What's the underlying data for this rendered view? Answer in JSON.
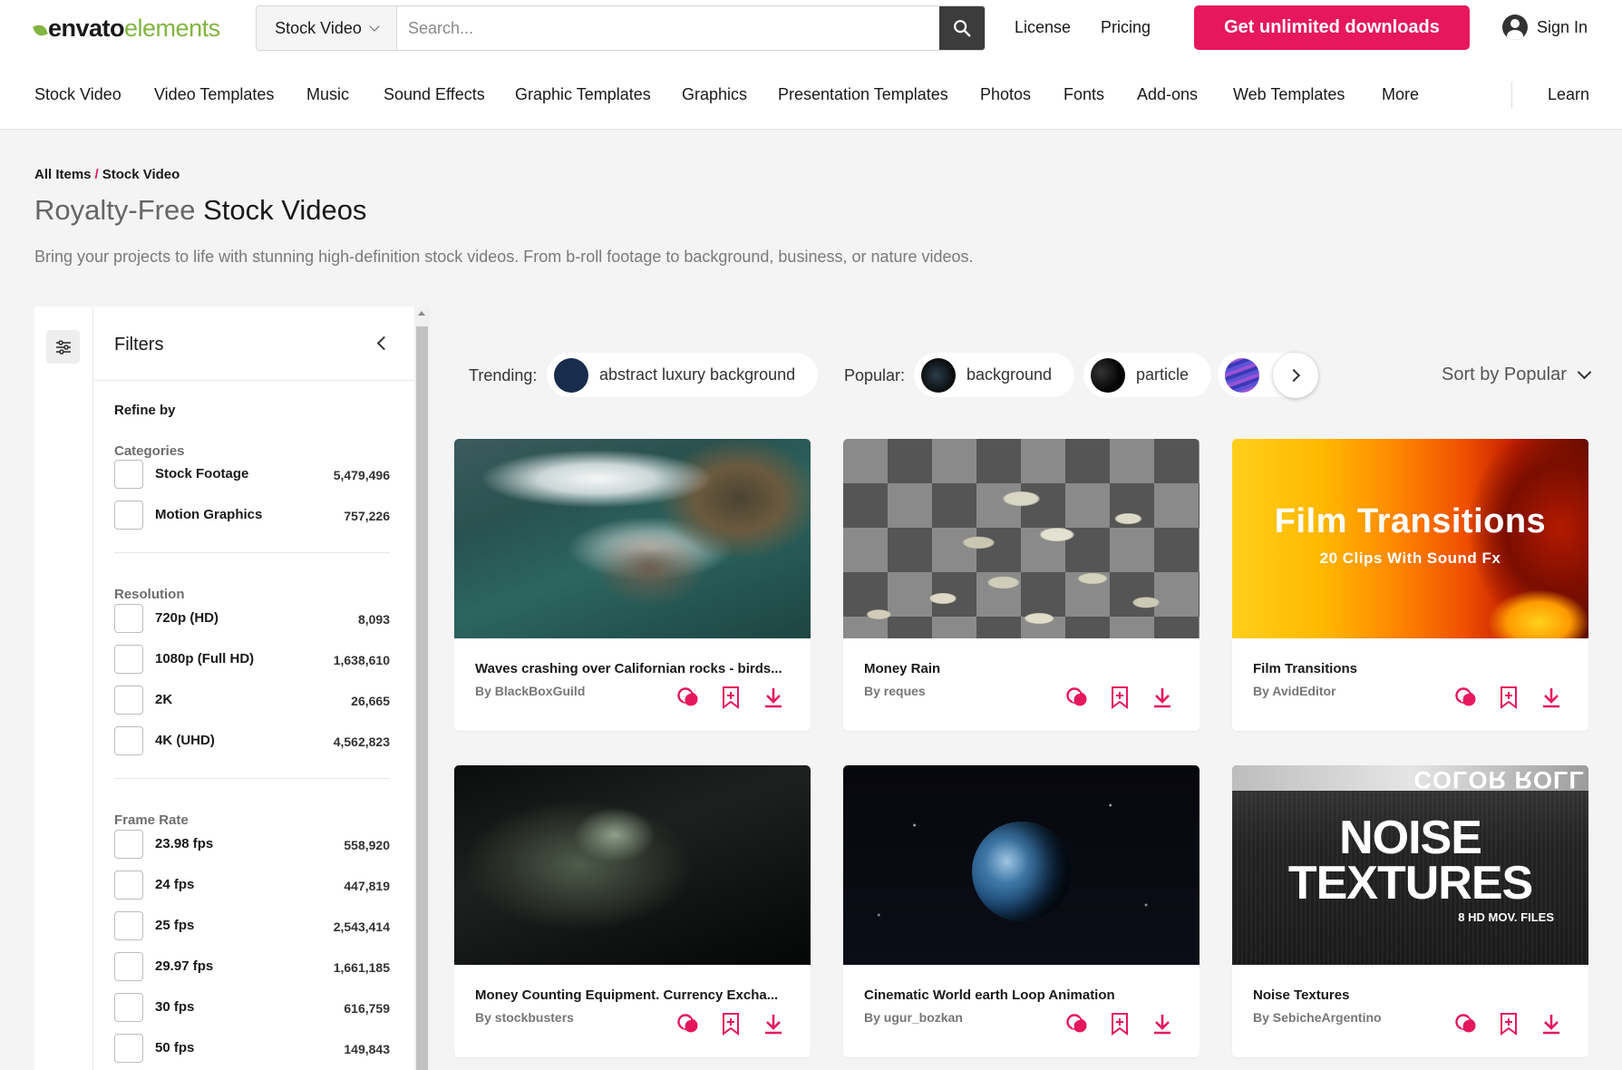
{
  "header": {
    "logo_part1": "envato",
    "logo_part2": "elements",
    "search_category": "Stock Video",
    "search_placeholder": "Search...",
    "license_link": "License",
    "pricing_link": "Pricing",
    "cta_button": "Get unlimited downloads",
    "sign_in": "Sign In"
  },
  "nav": {
    "items": [
      "Stock Video",
      "Video Templates",
      "Music",
      "Sound Effects",
      "Graphic Templates",
      "Graphics",
      "Presentation Templates",
      "Photos",
      "Fonts",
      "Add-ons",
      "Web Templates",
      "More"
    ],
    "learn": "Learn"
  },
  "hero": {
    "breadcrumb_root": "All Items",
    "breadcrumb_sep": "/",
    "breadcrumb_current": "Stock Video",
    "title_light": "Royalty-Free",
    "title_bold": "Stock Videos",
    "description": "Bring your projects to life with stunning high-definition stock videos. From b-roll footage to background, business, or nature videos."
  },
  "filters": {
    "title": "Filters",
    "refine_by": "Refine by",
    "groups": [
      {
        "name": "Categories",
        "options": [
          {
            "label": "Stock Footage",
            "count": "5,479,496"
          },
          {
            "label": "Motion Graphics",
            "count": "757,226"
          }
        ]
      },
      {
        "name": "Resolution",
        "options": [
          {
            "label": "720p (HD)",
            "count": "8,093"
          },
          {
            "label": "1080p (Full HD)",
            "count": "1,638,610"
          },
          {
            "label": "2K",
            "count": "26,665"
          },
          {
            "label": "4K (UHD)",
            "count": "4,562,823"
          }
        ]
      },
      {
        "name": "Frame Rate",
        "options": [
          {
            "label": "23.98 fps",
            "count": "558,920"
          },
          {
            "label": "24 fps",
            "count": "447,819"
          },
          {
            "label": "25 fps",
            "count": "2,543,414"
          },
          {
            "label": "29.97 fps",
            "count": "1,661,185"
          },
          {
            "label": "30 fps",
            "count": "616,759"
          },
          {
            "label": "50 fps",
            "count": "149,843"
          }
        ]
      }
    ]
  },
  "tags": {
    "trending_label": "Trending:",
    "trending": [
      {
        "label": "abstract luxury background"
      }
    ],
    "popular_label": "Popular:",
    "popular": [
      {
        "label": "background"
      },
      {
        "label": "particle"
      }
    ],
    "sort": "Sort by Popular"
  },
  "cards": [
    {
      "title": "Waves crashing over Californian rocks - birds...",
      "author": "By BlackBoxGuild"
    },
    {
      "title": "Money Rain",
      "author": "By reques"
    },
    {
      "title": "Film Transitions",
      "author": "By AvidEditor",
      "thumb_title": "Film Transitions",
      "thumb_subtitle": "20 Clips With Sound Fx"
    },
    {
      "title": "Money Counting Equipment. Currency Excha...",
      "author": "By stockbusters"
    },
    {
      "title": "Cinematic World earth Loop Animation",
      "author": "By ugur_bozkan"
    },
    {
      "title": "Noise Textures",
      "author": "By SebicheArgentino",
      "thumb_line1": "NOISE",
      "thumb_line2": "TEXTURES",
      "thumb_line3": "8 HD MOV. FILES",
      "thumb_roll": "COLOR ROLL"
    }
  ],
  "colors": {
    "accent": "#e6175c",
    "brand_green": "#82b541",
    "search_button": "#3c3c3c"
  }
}
